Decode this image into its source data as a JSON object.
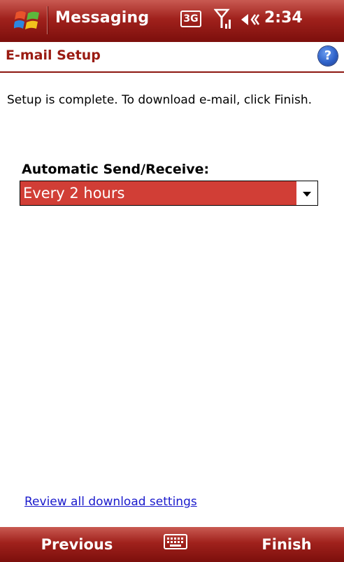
{
  "statusbar": {
    "app_title": "Messaging",
    "network_badge": "3G",
    "time": "2:34",
    "icons": [
      "windows-start-icon",
      "3g-icon",
      "signal-icon",
      "volume-icon"
    ]
  },
  "header": {
    "title": "E-mail Setup",
    "help_symbol": "?"
  },
  "main": {
    "info_text": "Setup is complete.  To download e-mail, click Finish.",
    "send_receive_label": "Automatic Send/Receive:",
    "send_receive_value": "Every 2 hours",
    "review_link": "Review all download settings"
  },
  "softkeys": {
    "left": "Previous",
    "right": "Finish",
    "center_icon": "keyboard-icon"
  },
  "colors": {
    "title_bar": "#a0211c",
    "header_text": "#9a1b12",
    "selection": "#d13e36",
    "link": "#1a1acc"
  }
}
